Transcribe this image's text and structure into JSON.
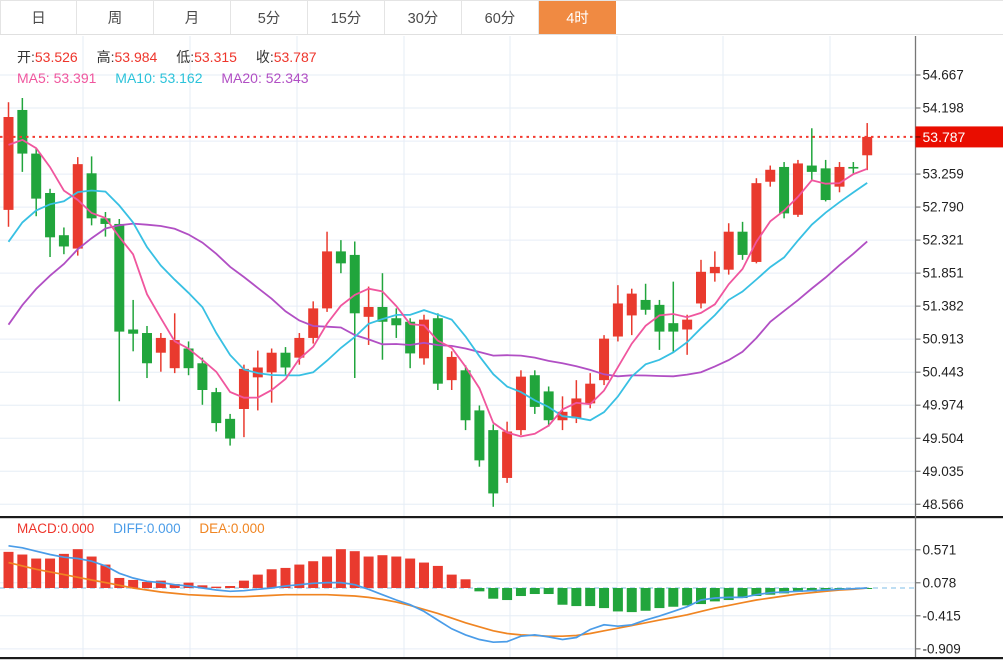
{
  "header": {
    "tabs": [
      {
        "label": "日"
      },
      {
        "label": "周"
      },
      {
        "label": "月"
      },
      {
        "label": "5分"
      },
      {
        "label": "15分"
      },
      {
        "label": "30分"
      },
      {
        "label": "60分"
      },
      {
        "label": "4时",
        "active": true
      }
    ],
    "active_tab": "4时",
    "active_tab_color": "#f08a42"
  },
  "main_panel": {
    "ohlc": {
      "open_label": "开:",
      "open": "53.526",
      "high_label": "高:",
      "high": "53.984",
      "low_label": "低:",
      "low": "53.315",
      "close_label": "收:",
      "close": "53.787"
    },
    "ma_legend": [
      {
        "label": "MA5:",
        "value": "53.391",
        "color": "#f0569e"
      },
      {
        "label": "MA10:",
        "value": "53.162",
        "color": "#2cc3da"
      },
      {
        "label": "MA20:",
        "value": "52.343",
        "color": "#b14fc4"
      }
    ],
    "price_tag": "53.787"
  },
  "macd_panel": {
    "legend": [
      {
        "label": "MACD:",
        "value": "0.000",
        "color": "#ee352b"
      },
      {
        "label": "DIFF:",
        "value": "0.000",
        "color": "#4a9ce8"
      },
      {
        "label": "DEA:",
        "value": "0.000",
        "color": "#f08522"
      }
    ]
  },
  "colors": {
    "up_candle": "#e93a2e",
    "down_candle": "#21a53c",
    "ma5": "#f0569e",
    "ma10": "#38c0e3",
    "ma20": "#b14fc4",
    "diff_line": "#4a9ce8",
    "dea_line": "#f08522",
    "grid": "#e6edf6",
    "axis": "#777777",
    "tick_text": "#222222",
    "price_tag_bg": "#e90d00",
    "dotted_price_line": "#f3392e",
    "separator": "#1b1b1b",
    "zero_dash": "#a9d4ef"
  },
  "chart_data": {
    "type": "candlestick",
    "note": "red = up candle, green = down candle (CN convention)",
    "main": {
      "y_axis_ticks": [
        54.667,
        54.198,
        53.259,
        52.79,
        52.321,
        51.851,
        51.382,
        50.913,
        50.443,
        49.974,
        49.504,
        49.035,
        48.566
      ],
      "unlabeled_grid": 53.728,
      "current_price_line": 53.787,
      "candles_ohlc": [
        [
          52.75,
          54.28,
          52.51,
          54.07
        ],
        [
          54.17,
          54.34,
          53.29,
          53.55
        ],
        [
          53.55,
          53.62,
          52.66,
          52.91
        ],
        [
          52.99,
          53.05,
          52.08,
          52.36
        ],
        [
          52.39,
          52.5,
          52.12,
          52.23
        ],
        [
          52.2,
          53.5,
          52.1,
          53.4
        ],
        [
          53.27,
          53.51,
          52.53,
          52.63
        ],
        [
          52.63,
          52.72,
          52.37,
          52.55
        ],
        [
          52.55,
          52.62,
          50.03,
          51.02
        ],
        [
          51.05,
          51.47,
          50.74,
          50.99
        ],
        [
          51.0,
          51.1,
          50.36,
          50.57
        ],
        [
          50.72,
          51.0,
          50.45,
          50.93
        ],
        [
          50.5,
          51.28,
          50.43,
          50.9
        ],
        [
          50.78,
          50.88,
          50.4,
          50.5
        ],
        [
          50.57,
          50.65,
          49.98,
          50.19
        ],
        [
          50.16,
          50.22,
          49.6,
          49.72
        ],
        [
          49.78,
          49.85,
          49.4,
          49.5
        ],
        [
          49.92,
          50.55,
          49.52,
          50.49
        ],
        [
          50.37,
          50.75,
          49.9,
          50.51
        ],
        [
          50.44,
          50.78,
          50.01,
          50.72
        ],
        [
          50.72,
          50.8,
          50.4,
          50.51
        ],
        [
          50.65,
          51.0,
          50.55,
          50.93
        ],
        [
          50.93,
          51.45,
          50.85,
          51.35
        ],
        [
          51.35,
          52.44,
          51.3,
          52.16
        ],
        [
          52.16,
          52.32,
          51.85,
          51.99
        ],
        [
          52.11,
          52.3,
          50.36,
          51.28
        ],
        [
          51.23,
          51.66,
          50.83,
          51.37
        ],
        [
          51.37,
          51.85,
          50.62,
          51.16
        ],
        [
          51.21,
          51.35,
          50.93,
          51.11
        ],
        [
          51.16,
          51.21,
          50.5,
          50.71
        ],
        [
          50.64,
          51.26,
          50.55,
          51.19
        ],
        [
          51.21,
          51.28,
          50.19,
          50.28
        ],
        [
          50.33,
          50.74,
          50.19,
          50.66
        ],
        [
          50.47,
          50.54,
          49.62,
          49.76
        ],
        [
          49.9,
          49.97,
          49.1,
          49.19
        ],
        [
          49.62,
          49.7,
          48.53,
          48.72
        ],
        [
          48.94,
          49.74,
          48.87,
          49.6
        ],
        [
          49.62,
          50.47,
          49.55,
          50.38
        ],
        [
          50.4,
          50.47,
          49.85,
          49.95
        ],
        [
          50.17,
          50.24,
          49.67,
          49.76
        ],
        [
          49.76,
          50.1,
          49.62,
          49.88
        ],
        [
          49.79,
          50.33,
          49.72,
          50.07
        ],
        [
          50.0,
          50.43,
          49.93,
          50.28
        ],
        [
          50.33,
          50.97,
          50.26,
          50.92
        ],
        [
          50.95,
          51.68,
          50.88,
          51.42
        ],
        [
          51.25,
          51.63,
          50.97,
          51.56
        ],
        [
          51.47,
          51.7,
          51.26,
          51.33
        ],
        [
          51.4,
          51.47,
          50.76,
          51.02
        ],
        [
          51.14,
          51.73,
          50.73,
          51.02
        ],
        [
          51.05,
          51.26,
          50.69,
          51.19
        ],
        [
          51.42,
          52.04,
          51.35,
          51.87
        ],
        [
          51.85,
          52.16,
          51.73,
          51.94
        ],
        [
          51.9,
          52.56,
          51.83,
          52.44
        ],
        [
          52.44,
          52.58,
          52.04,
          52.11
        ],
        [
          52.01,
          53.2,
          51.99,
          53.13
        ],
        [
          53.15,
          53.38,
          53.08,
          53.32
        ],
        [
          53.36,
          53.43,
          52.63,
          52.7
        ],
        [
          52.68,
          53.46,
          52.65,
          53.41
        ],
        [
          53.38,
          53.91,
          53.17,
          53.29
        ],
        [
          53.34,
          53.46,
          52.87,
          52.89
        ],
        [
          53.08,
          53.43,
          53.0,
          53.36
        ],
        [
          53.36,
          53.43,
          53.26,
          53.34
        ],
        [
          53.526,
          53.984,
          53.315,
          53.787
        ]
      ],
      "ma_seed_closes": {
        "ma5": [
          53.2,
          53.5,
          53.7,
          53.9
        ],
        "ma10": [
          50.8,
          51.2,
          51.5,
          51.8,
          52.1,
          52.4,
          52.7,
          53.0,
          53.4
        ],
        "ma20": [
          48.0,
          48.3,
          48.6,
          48.9,
          49.2,
          49.5,
          49.8,
          50.1,
          50.5,
          50.9,
          51.3,
          51.7,
          52.1,
          52.5,
          52.9,
          53.2,
          53.4,
          53.6,
          53.8
        ]
      }
    },
    "macd": {
      "y_axis_ticks": [
        0.571,
        0.078,
        -0.415,
        -0.909
      ],
      "hist": [
        0.54,
        0.5,
        0.44,
        0.44,
        0.51,
        0.58,
        0.47,
        0.35,
        0.15,
        0.12,
        0.09,
        0.11,
        0.06,
        0.08,
        0.04,
        0.02,
        0.03,
        0.11,
        0.2,
        0.28,
        0.3,
        0.35,
        0.4,
        0.47,
        0.58,
        0.55,
        0.47,
        0.49,
        0.47,
        0.44,
        0.38,
        0.33,
        0.2,
        0.13,
        -0.05,
        -0.16,
        -0.18,
        -0.12,
        -0.09,
        -0.09,
        -0.25,
        -0.27,
        -0.27,
        -0.3,
        -0.35,
        -0.36,
        -0.34,
        -0.3,
        -0.28,
        -0.26,
        -0.24,
        -0.2,
        -0.18,
        -0.15,
        -0.12,
        -0.1,
        -0.08,
        -0.06,
        -0.05,
        -0.04,
        -0.03,
        -0.02,
        -0.01
      ],
      "diff": [
        0.63,
        0.6,
        0.55,
        0.5,
        0.46,
        0.44,
        0.4,
        0.33,
        0.22,
        0.15,
        0.1,
        0.08,
        0.05,
        0.03,
        0.0,
        -0.03,
        -0.05,
        -0.04,
        -0.02,
        0.0,
        0.03,
        0.05,
        0.07,
        0.08,
        0.08,
        0.05,
        -0.02,
        -0.1,
        -0.18,
        -0.25,
        -0.35,
        -0.48,
        -0.61,
        -0.7,
        -0.77,
        -0.81,
        -0.8,
        -0.72,
        -0.7,
        -0.73,
        -0.77,
        -0.74,
        -0.62,
        -0.55,
        -0.57,
        -0.55,
        -0.48,
        -0.42,
        -0.35,
        -0.28,
        -0.18,
        -0.15,
        -0.14,
        -0.14,
        -0.1,
        -0.07,
        -0.06,
        -0.05,
        -0.04,
        -0.03,
        -0.02,
        -0.01,
        0.0
      ],
      "dea": [
        0.38,
        0.33,
        0.28,
        0.24,
        0.2,
        0.16,
        0.12,
        0.08,
        0.04,
        0.0,
        -0.03,
        -0.06,
        -0.08,
        -0.1,
        -0.11,
        -0.12,
        -0.13,
        -0.13,
        -0.12,
        -0.11,
        -0.1,
        -0.1,
        -0.1,
        -0.1,
        -0.11,
        -0.12,
        -0.14,
        -0.17,
        -0.21,
        -0.26,
        -0.32,
        -0.38,
        -0.45,
        -0.52,
        -0.58,
        -0.64,
        -0.68,
        -0.7,
        -0.71,
        -0.72,
        -0.72,
        -0.71,
        -0.68,
        -0.64,
        -0.6,
        -0.56,
        -0.52,
        -0.48,
        -0.44,
        -0.4,
        -0.35,
        -0.3,
        -0.26,
        -0.22,
        -0.18,
        -0.15,
        -0.12,
        -0.09,
        -0.07,
        -0.05,
        -0.03,
        -0.02,
        0.0
      ]
    }
  }
}
